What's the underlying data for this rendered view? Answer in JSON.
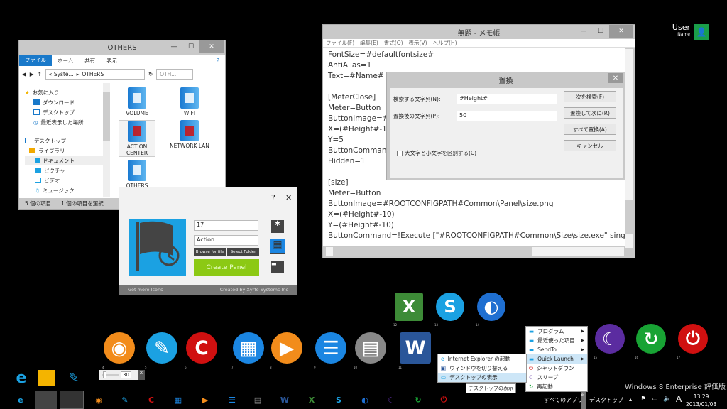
{
  "user": {
    "name": "User",
    "sub": "Name"
  },
  "explorer": {
    "title": "OTHERS",
    "ribbon": [
      "ファイル",
      "ホーム",
      "共有",
      "表示"
    ],
    "address": [
      "« Syste...",
      "OTHERS"
    ],
    "search_placeholder": "OTH...",
    "tree": [
      "お気に入り",
      "ダウンロード",
      "デスクトップ",
      "最近表示した場所",
      "デスクトップ",
      "ライブラリ",
      "ドキュメント",
      "ピクチャ",
      "ビデオ",
      "ミュージック"
    ],
    "items": [
      "VOLUME",
      "WIFI",
      "ACTION CENTER",
      "NETWORK LAN",
      "OTHERS"
    ],
    "status_count": "5 個の項目",
    "status_selected": "1 個の項目を選択"
  },
  "notepad": {
    "title": "無題 - メモ帳",
    "menu": [
      "ファイル(F)",
      "編集(E)",
      "書式(O)",
      "表示(V)",
      "ヘルプ(H)"
    ],
    "lines_left": [
      "FontSize=#defaultfontsize#",
      "AntiAlias=1",
      "Text=#Name#",
      "",
      "[MeterClose]",
      "Meter=Button",
      "ButtonImage=#R",
      "X=(#Height#-10)",
      "Y=5",
      "ButtonCommand",
      "Hidden=1"
    ],
    "lines_full": [
      "",
      "[size]",
      "Meter=Button",
      "ButtonImage=#ROOTCONFIGPATH#Common\\Panel\\size.png",
      "X=(#Height#-10)",
      "Y=(#Height#-10)",
      "ButtonCommand=!Execute [\"#ROOTCONFIGPATH#Common\\Size\\size.exe\" single \"#CUR"
    ]
  },
  "replace": {
    "title": "置換",
    "find_label": "検索する文字列(N):",
    "find_value": "#Height#",
    "replace_label": "置換後の文字列(P):",
    "replace_value": "50",
    "match_case": "大文字と小文字を区別する(C)",
    "buttons": [
      "次を検索(F)",
      "置換して次に(R)",
      "すべて置換(A)",
      "キャンセル"
    ]
  },
  "panel": {
    "help": "?",
    "close": "✕",
    "field1": "17",
    "field2": "Action",
    "browse": "Browse for file",
    "select_folder": "Select Folder",
    "create": "Create Panel",
    "more": "Get more Icons",
    "credit": "Created by Xyrfo Systems Inc",
    "accent": "#1ba1e2",
    "green": "#8cc914"
  },
  "slider": {
    "value": "30",
    "close": "x"
  },
  "dock": {
    "row1": [
      {
        "n": "12",
        "g": "X",
        "c": "#3d8b37"
      },
      {
        "n": "13",
        "g": "S",
        "c": "#1ba1e2"
      },
      {
        "n": "14",
        "g": "◐",
        "c": "#1f6fd1"
      }
    ],
    "row2": [
      {
        "n": "4",
        "g": "◉",
        "c": "#f28c1b"
      },
      {
        "n": "5",
        "g": "✎",
        "c": "#1ba1e2"
      },
      {
        "n": "6",
        "g": "C",
        "c": "#d01010"
      },
      {
        "n": "7",
        "g": "▦",
        "c": "#1b86e2"
      },
      {
        "n": "8",
        "g": "▶",
        "c": "#f28c1b"
      },
      {
        "n": "9",
        "g": "☰",
        "c": "#1b86e2"
      },
      {
        "n": "10",
        "g": "▤",
        "c": "#888888"
      },
      {
        "n": "11",
        "g": "W",
        "c": "#2a5699"
      }
    ],
    "right": [
      {
        "n": "15",
        "g": "☾",
        "c": "#5b2ca0"
      },
      {
        "n": "16",
        "g": "↻",
        "c": "#18a334"
      },
      {
        "n": "17",
        "g": "⏻",
        "c": "#d01010"
      }
    ]
  },
  "start_menu": [
    "プログラム",
    "最近使った項目",
    "SendTo",
    "Quick Launch",
    "シャットダウン",
    "スリープ",
    "再起動"
  ],
  "jump_list": [
    "Internet Explorer の起動",
    "ウィンドウを切り替える",
    "デスクトップの表示"
  ],
  "tooltip": "デスクトップの表示",
  "taskbar": {
    "all_apps": "すべてのアプリ",
    "desktop": "デスクトップ",
    "ime": "A",
    "time": "13:29",
    "date": "2013/01/03",
    "edition": "Windows 8 Enterprise 評価版",
    "icons": [
      {
        "g": "e",
        "c": "#1ba1e2"
      },
      {
        "g": "▬",
        "c": "#f4b400"
      },
      {
        "g": "✎",
        "c": "#1ba1e2"
      },
      {
        "g": "◉",
        "c": "#f28c1b"
      },
      {
        "g": "✎",
        "c": "#1ba1e2"
      },
      {
        "g": "C",
        "c": "#d01010"
      },
      {
        "g": "▦",
        "c": "#1b86e2"
      },
      {
        "g": "▶",
        "c": "#f28c1b"
      },
      {
        "g": "☰",
        "c": "#1b86e2"
      },
      {
        "g": "▤",
        "c": "#888888"
      },
      {
        "g": "W",
        "c": "#2a5699"
      },
      {
        "g": "X",
        "c": "#3d8b37"
      },
      {
        "g": "S",
        "c": "#1ba1e2"
      },
      {
        "g": "◐",
        "c": "#1f6fd1"
      },
      {
        "g": "☾",
        "c": "#5b2ca0"
      },
      {
        "g": "↻",
        "c": "#18a334"
      },
      {
        "g": "⏻",
        "c": "#d01010"
      }
    ]
  }
}
